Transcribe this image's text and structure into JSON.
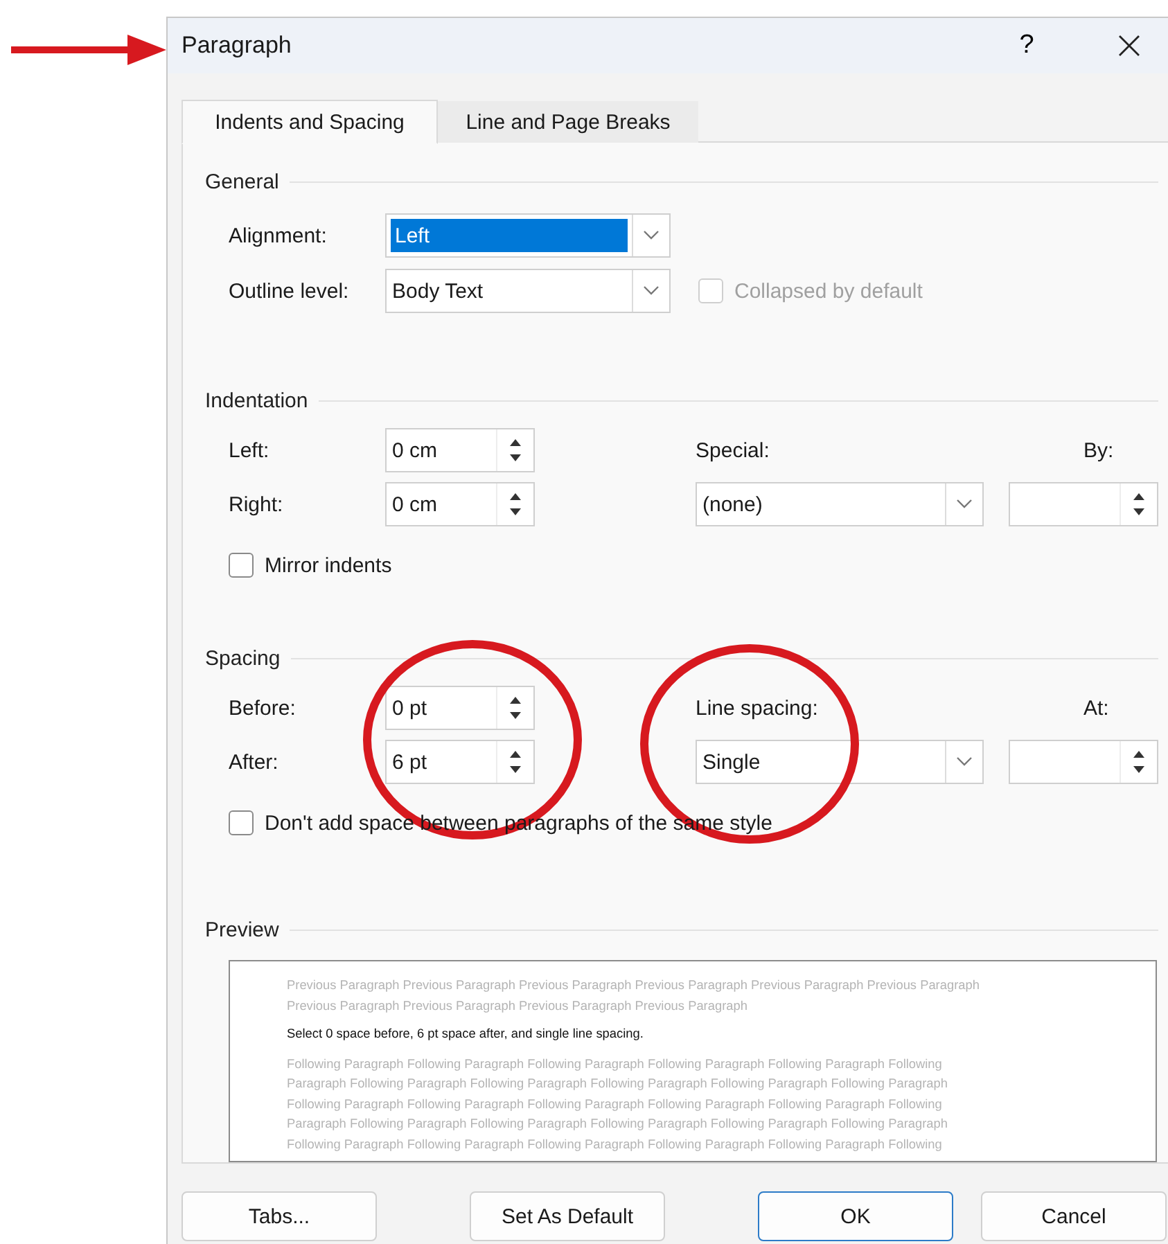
{
  "annotations": [
    {
      "kind": "arrow"
    },
    {
      "kind": "circle"
    },
    {
      "kind": "circle"
    }
  ],
  "window": {
    "title": "Paragraph",
    "help": "?"
  },
  "tabs": [
    {
      "label": "Indents and Spacing",
      "selected": true
    },
    {
      "label": "Line and Page Breaks",
      "selected": false
    }
  ],
  "general": {
    "heading": "General",
    "alignment": {
      "label": "Alignment:",
      "value": "Left",
      "highlighted": true
    },
    "outline_level": {
      "label": "Outline level:",
      "value": "Body Text"
    },
    "collapsed": {
      "label": "Collapsed by default",
      "checked": false,
      "disabled": true
    }
  },
  "indentation": {
    "heading": "Indentation",
    "left": {
      "label": "Left:",
      "value": "0 cm"
    },
    "right": {
      "label": "Right:",
      "value": "0 cm"
    },
    "special": {
      "label": "Special:",
      "value": "(none)"
    },
    "by": {
      "label": "By:"
    },
    "mirror": {
      "label": "Mirror indents",
      "checked": false,
      "disabled": false
    }
  },
  "spacing": {
    "heading": "Spacing",
    "before": {
      "label": "Before:",
      "value": "0 pt"
    },
    "after": {
      "label": "After:",
      "value": "6 pt"
    },
    "line_spacing": {
      "label": "Line spacing:",
      "value": "Single"
    },
    "at": {
      "label": "At:"
    },
    "dont_add": {
      "label": "Don't add space between paragraphs of the same style",
      "checked": false,
      "disabled": false
    }
  },
  "preview": {
    "heading": "Preview",
    "previous_lines": [
      "Previous Paragraph Previous Paragraph Previous Paragraph Previous Paragraph Previous Paragraph Previous Paragraph",
      "Previous Paragraph Previous Paragraph Previous Paragraph Previous Paragraph"
    ],
    "sample": "Select 0 space before, 6 pt space after, and single line spacing.",
    "following_lines": [
      "Following Paragraph Following Paragraph Following Paragraph Following Paragraph Following Paragraph Following",
      "Paragraph Following Paragraph Following Paragraph Following Paragraph Following Paragraph Following Paragraph",
      "Following Paragraph Following Paragraph Following Paragraph Following Paragraph Following Paragraph Following",
      "Paragraph Following Paragraph Following Paragraph Following Paragraph Following Paragraph Following Paragraph",
      "Following Paragraph Following Paragraph Following Paragraph Following Paragraph Following Paragraph Following"
    ]
  },
  "buttons": [
    {
      "label": "Tabs...",
      "default": false
    },
    {
      "label": "Set As Default",
      "default": false
    },
    {
      "label": "OK",
      "default": true
    },
    {
      "label": "Cancel",
      "default": false
    }
  ]
}
